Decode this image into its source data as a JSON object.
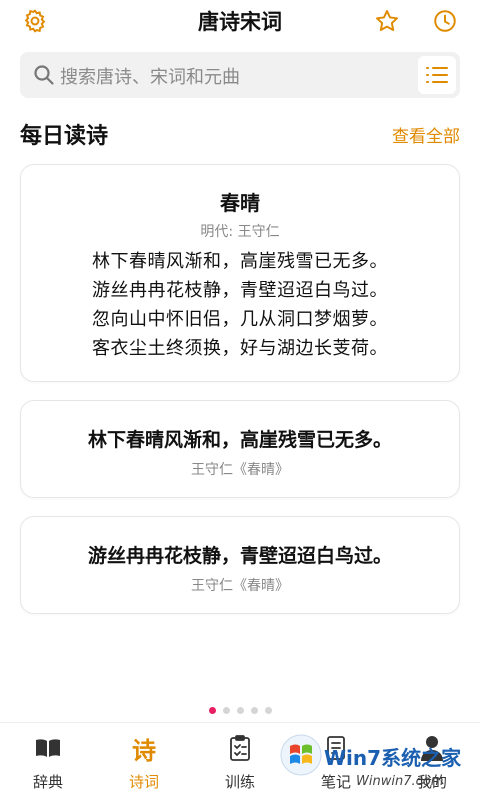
{
  "header": {
    "title": "唐诗宋词",
    "icons": {
      "settings": "gear-icon",
      "favorite": "star-icon",
      "history": "clock-icon"
    }
  },
  "search": {
    "placeholder": "搜索唐诗、宋词和元曲"
  },
  "daily": {
    "section_title": "每日读诗",
    "view_all": "查看全部",
    "poem": {
      "title": "春晴",
      "author": "明代: 王守仁",
      "lines": [
        "林下春晴风渐和，高崖残雪已无多。",
        "游丝冉冉花枝静，青壁迢迢白鸟过。",
        "忽向山中怀旧侣，几从洞口梦烟萝。",
        "客衣尘土终须换，好与湖边长芰荷。"
      ]
    },
    "quotes": [
      {
        "text": "林下春晴风渐和，高崖残雪已无多。",
        "source": "王守仁《春晴》"
      },
      {
        "text": "游丝冉冉花枝静，青壁迢迢白鸟过。",
        "source": "王守仁《春晴》"
      }
    ]
  },
  "pager": {
    "count": 5,
    "active_index": 0
  },
  "tabs": [
    {
      "label": "辞典",
      "icon": "book-icon",
      "active": false
    },
    {
      "label": "诗词",
      "icon": "poem-character-icon",
      "active": true
    },
    {
      "label": "训练",
      "icon": "clipboard-check-icon",
      "active": false
    },
    {
      "label": "笔记",
      "icon": "notebook-icon",
      "active": false
    },
    {
      "label": "我的",
      "icon": "person-icon",
      "active": false
    }
  ],
  "watermark": {
    "text": "Win7系统之家",
    "url": "Winwin7.com"
  },
  "colors": {
    "accent": "#e08a00",
    "active_dot": "#e91e63",
    "card_border": "#e6e6e6"
  }
}
